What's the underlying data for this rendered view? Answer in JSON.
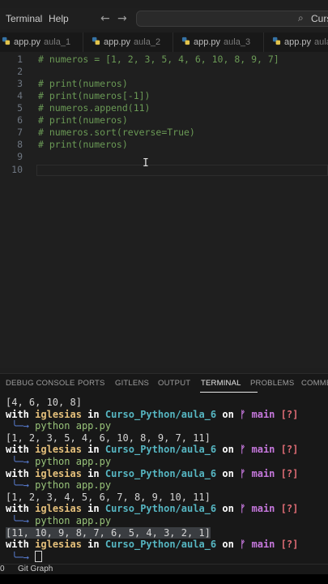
{
  "menu": {
    "terminal": "Terminal",
    "help": "Help"
  },
  "nav": {
    "back": "←",
    "forward": "→"
  },
  "search": {
    "icon": "⌕",
    "text": "Curs"
  },
  "tabs": [
    {
      "file": "app.py",
      "dir": "aula_1"
    },
    {
      "file": "app.py",
      "dir": "aula_2"
    },
    {
      "file": "app.py",
      "dir": "aula_3"
    },
    {
      "file": "app.py",
      "dir": "aula_"
    }
  ],
  "editor": {
    "lines": [
      {
        "n": "1",
        "text": "# numeros = [1, 2, 3, 5, 4, 6, 10, 8, 9, 7]"
      },
      {
        "n": "2",
        "text": ""
      },
      {
        "n": "3",
        "text": "# print(numeros)"
      },
      {
        "n": "4",
        "text": "# print(numeros[-1])"
      },
      {
        "n": "5",
        "text": "# numeros.append(11)"
      },
      {
        "n": "6",
        "text": "# print(numeros)"
      },
      {
        "n": "7",
        "text": "# numeros.sort(reverse=True)"
      },
      {
        "n": "8",
        "text": "# print(numeros)"
      },
      {
        "n": "9",
        "text": ""
      },
      {
        "n": "10",
        "text": ""
      }
    ],
    "cursor_glyph": "I"
  },
  "panel": {
    "tabs": [
      "DEBUG CONSOLE",
      "PORTS",
      "GITLENS",
      "OUTPUT",
      "TERMINAL",
      "PROBLEMS",
      "COMME"
    ],
    "active_tab": "TERMINAL"
  },
  "terminal": {
    "with": "with",
    "user": "iglesias",
    "in": "in",
    "path": "Curso_Python/aula_6",
    "on": "on",
    "branch_icon": "ᚠ",
    "branch": "main",
    "status": "[?]",
    "arrow": "╰─→",
    "cmd": "python app.py",
    "out_first": "[4, 6, 10, 8]",
    "out1": "[1, 2, 3, 5, 4, 6, 10, 8, 9, 7, 11]",
    "out2": "[1, 2, 3, 4, 5, 6, 7, 8, 9, 10, 11]",
    "out3": "[11, 10, 9, 8, 7, 6, 5, 4, 3, 2, 1]"
  },
  "status": {
    "left": "0",
    "git_graph": "Git Graph"
  },
  "colors": {
    "comment": "#6a9955",
    "path": "#56b6c2",
    "user": "#e5c07b",
    "branch": "#c678dd",
    "cmd": "#98c379"
  }
}
